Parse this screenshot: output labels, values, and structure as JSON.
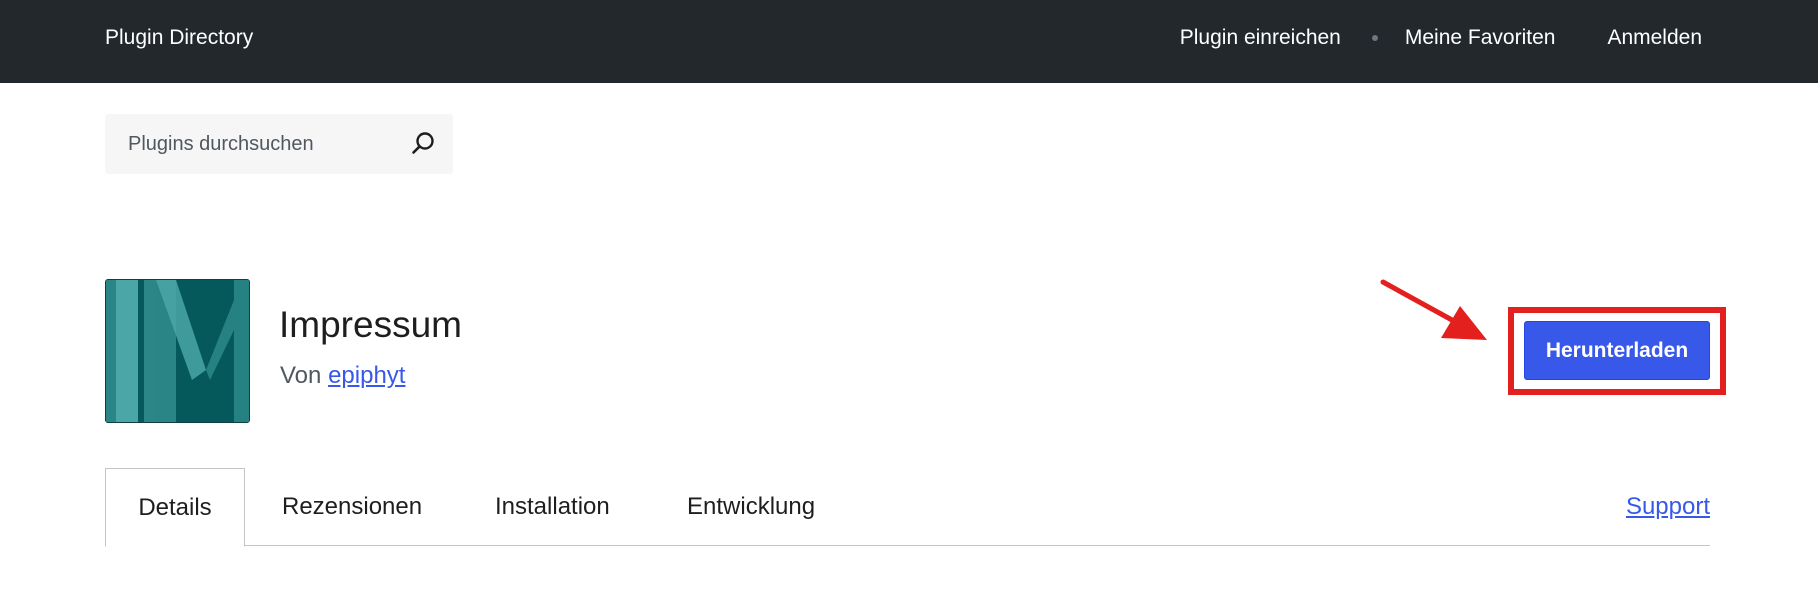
{
  "header": {
    "brand": "Plugin Directory",
    "nav": {
      "submit": "Plugin einreichen",
      "favorites": "Meine Favoriten",
      "login": "Anmelden"
    }
  },
  "search": {
    "placeholder": "Plugins durchsuchen",
    "icon": "search-icon"
  },
  "plugin": {
    "name": "Impressum",
    "by_prefix": "Von",
    "author": "epiphyt",
    "download_label": "Herunterladen",
    "icon_colors": {
      "background": "#05595a",
      "stripe_light": "#4aa6a7",
      "stripe_mid": "#2a8586"
    }
  },
  "annotation": {
    "arrow_color": "#e3201e",
    "highlight_color": "#e3201e"
  },
  "tabs": {
    "details": "Details",
    "reviews": "Rezensionen",
    "installation": "Installation",
    "development": "Entwicklung",
    "support": "Support"
  }
}
